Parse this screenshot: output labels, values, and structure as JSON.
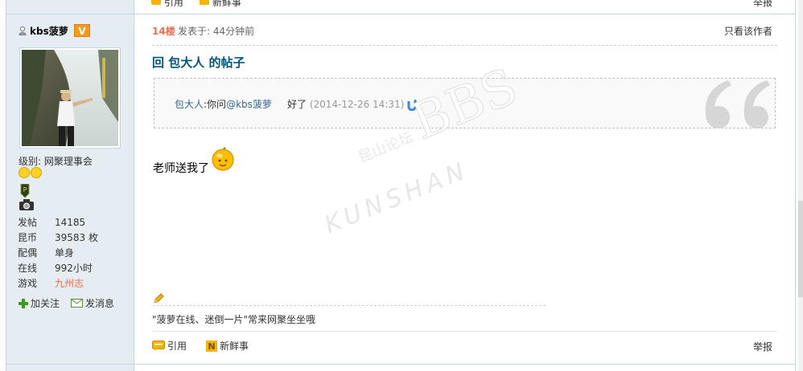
{
  "top": {
    "quote_partial": "引用",
    "news_partial": "新鲜事",
    "report_partial": "举报"
  },
  "user": {
    "name": "kbs菠萝",
    "badge": "V",
    "level": "级别: 网聚理事会",
    "stats": [
      {
        "key": "发帖",
        "value": "14185"
      },
      {
        "key": "昆币",
        "value": "39583 枚"
      },
      {
        "key": "配偶",
        "value": "单身"
      },
      {
        "key": "在线",
        "value": "992小时"
      },
      {
        "key": "游戏",
        "value": "九州志"
      }
    ],
    "follow_label": "加关注",
    "message_label": "发消息"
  },
  "post": {
    "floor": "14楼",
    "posted": "发表于: 44分钟前",
    "only_author": "只看该作者",
    "title": "回 包大人 的帖子",
    "quote": {
      "author": "包大人",
      "sep": ":你问",
      "mention": "@kbs菠萝",
      "reply": "好了",
      "time": "(2014-12-26 14:31)"
    },
    "body": "老师送我了",
    "signature": "\"菠萝在线、迷倒一片\"常来网聚坐坐哦",
    "actions": {
      "quote_label": "引用",
      "news_label": "新鲜事",
      "report_label": "举报"
    }
  },
  "watermark": {
    "latin": "KUNSHAN",
    "bbs": "BBS",
    "cn": "昆山论坛"
  },
  "colors": {
    "sidebar_bg": "#e5edf2",
    "border": "#c2d5e3",
    "floor": "#f26c4f",
    "title": "#00557b",
    "link": "#336699"
  }
}
